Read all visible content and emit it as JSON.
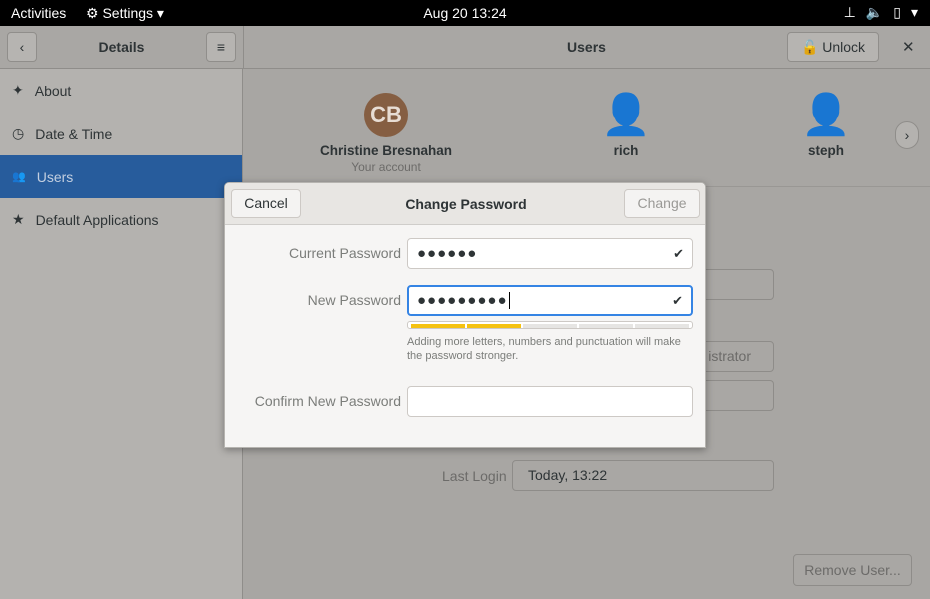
{
  "topbar": {
    "activities": "Activities",
    "app_menu": "Settings",
    "clock": "Aug 20  13:24"
  },
  "header": {
    "left_title": "Details",
    "title": "Users",
    "unlock": "Unlock"
  },
  "sidebar": {
    "items": [
      {
        "label": "About",
        "icon": "star-icon"
      },
      {
        "label": "Date & Time",
        "icon": "clock-icon"
      },
      {
        "label": "Users",
        "icon": "users-icon",
        "selected": true
      },
      {
        "label": "Default Applications",
        "icon": "star-icon"
      }
    ]
  },
  "users": [
    {
      "initials": "CB",
      "name": "Christine Bresnahan",
      "subtitle": "Your account",
      "avatar_color": "#855e42"
    },
    {
      "name": "rich"
    },
    {
      "name": "steph"
    }
  ],
  "main": {
    "admin_partial": "istrator",
    "last_login_label": "Last Login",
    "last_login": "Today, 13:22",
    "remove_user": "Remove User..."
  },
  "dialog": {
    "title": "Change Password",
    "cancel": "Cancel",
    "change": "Change",
    "current_label": "Current Password",
    "current_value": "●●●●●●",
    "new_label": "New Password",
    "new_value": "●●●●●●●●●",
    "strength_level": 2,
    "strength_max": 5,
    "strength_color": "#f5c211",
    "hint": "Adding more letters, numbers and punctuation will make the password stronger.",
    "confirm_label": "Confirm New Password",
    "confirm_value": ""
  }
}
